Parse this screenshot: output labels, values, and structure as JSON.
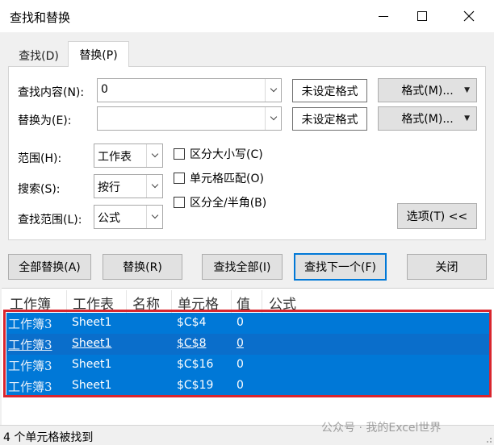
{
  "window": {
    "title": "查找和替换"
  },
  "tabs": [
    {
      "label": "查找(D)"
    },
    {
      "label": "替换(P)"
    }
  ],
  "find": {
    "label": "查找内容(N):",
    "value": "0",
    "format_status": "未设定格式",
    "format_button": "格式(M)..."
  },
  "replace": {
    "label": "替换为(E):",
    "value": "",
    "format_status": "未设定格式",
    "format_button": "格式(M)..."
  },
  "scope": {
    "label": "范围(H):",
    "value": "工作表"
  },
  "search": {
    "label": "搜索(S):",
    "value": "按行"
  },
  "lookin": {
    "label": "查找范围(L):",
    "value": "公式"
  },
  "options": {
    "match_case": "区分大小写(C)",
    "match_cell": "单元格匹配(O)",
    "match_width": "区分全/半角(B)",
    "options_button": "选项(T) <<"
  },
  "actions": {
    "replace_all": "全部替换(A)",
    "replace": "替换(R)",
    "find_all": "查找全部(I)",
    "find_next": "查找下一个(F)",
    "close": "关闭"
  },
  "results": {
    "columns": [
      "工作簿",
      "工作表",
      "名称",
      "单元格",
      "值",
      "公式"
    ],
    "rows": [
      {
        "book": "工作簿3",
        "sheet": "Sheet1",
        "cell": "$C$4",
        "value": "0"
      },
      {
        "book": "工作簿3",
        "sheet": "Sheet1",
        "cell": "$C$8",
        "value": "0"
      },
      {
        "book": "工作簿3",
        "sheet": "Sheet1",
        "cell": "$C$16",
        "value": "0"
      },
      {
        "book": "工作簿3",
        "sheet": "Sheet1",
        "cell": "$C$19",
        "value": "0"
      }
    ]
  },
  "status": {
    "text": "4 个单元格被找到"
  },
  "watermark": "公众号 · 我的Excel世界"
}
